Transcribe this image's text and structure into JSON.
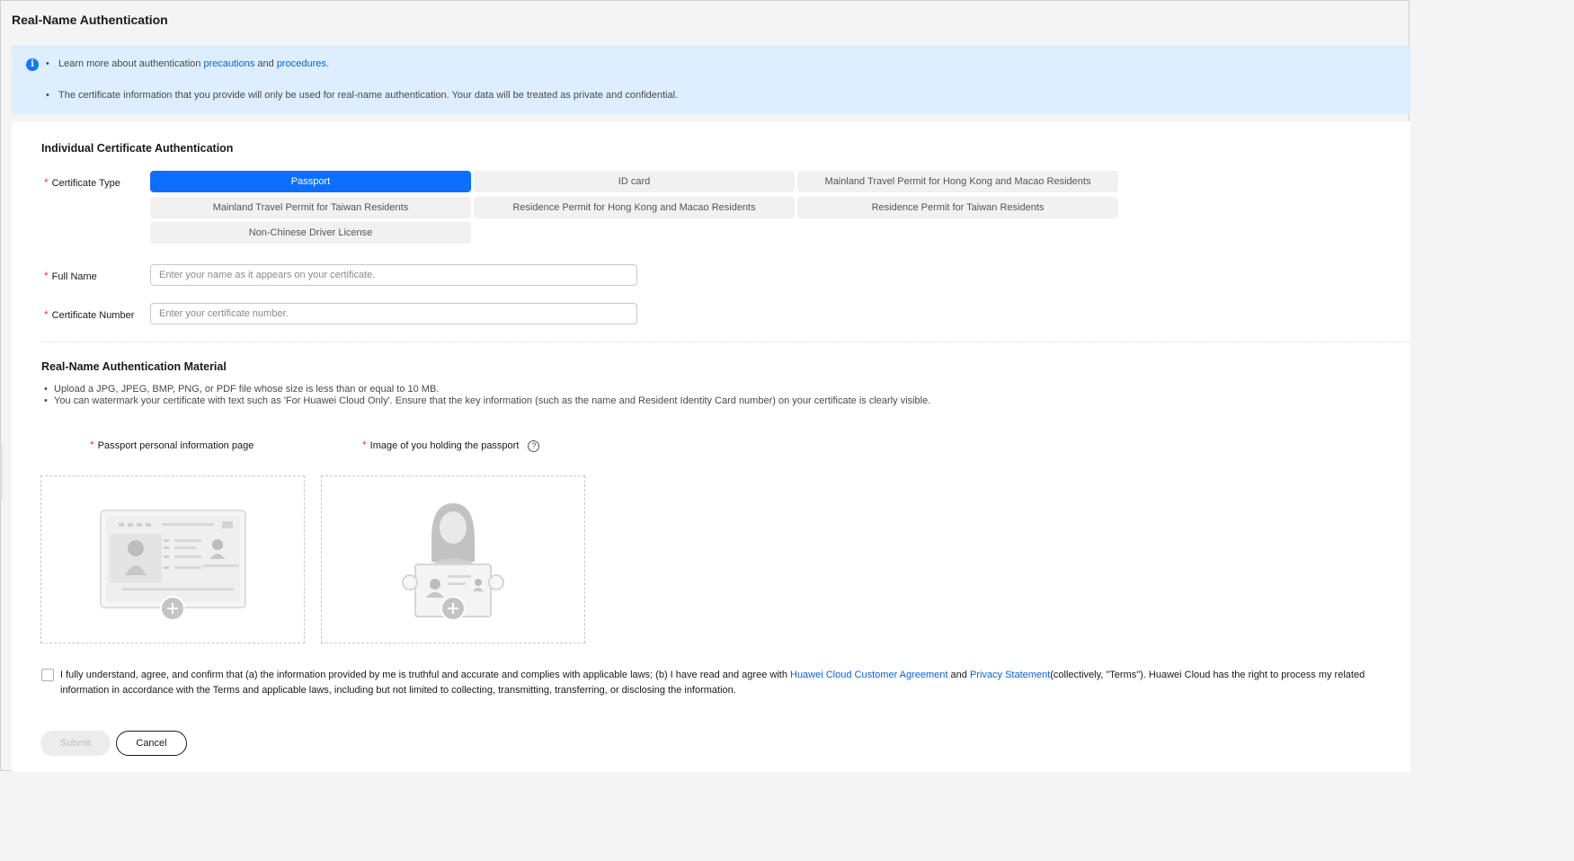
{
  "page": {
    "title": "Real-Name Authentication"
  },
  "notice": {
    "line1_prefix": "Learn more about authentication",
    "link_precautions": "precautions",
    "and": "and",
    "link_procedures": "procedures.",
    "line2": "The certificate information that you provide will only be used for real-name authentication. Your data will be treated as private and confidential."
  },
  "individual": {
    "section_title": "Individual Certificate Authentication",
    "certificate_type_label": "Certificate Type",
    "certificate_types": [
      "Passport",
      "ID card",
      "Mainland Travel Permit for Hong Kong and Macao Residents",
      "Mainland Travel Permit for Taiwan Residents",
      "Residence Permit for Hong Kong and Macao Residents",
      "Residence Permit for Taiwan Residents",
      "Non-Chinese Driver License"
    ],
    "selected_certificate_type": "Passport",
    "full_name_label": "Full Name",
    "full_name_placeholder": "Enter your name as it appears on your certificate.",
    "full_name_value": "",
    "certificate_number_label": "Certificate Number",
    "certificate_number_placeholder": "Enter your certificate number.",
    "certificate_number_value": ""
  },
  "material": {
    "section_title": "Real-Name Authentication Material",
    "notes": [
      "Upload a JPG, JPEG, BMP, PNG, or PDF file whose size is less than or equal to 10 MB.",
      "You can watermark your certificate with text such as 'For Huawei Cloud Only'. Ensure that the key information (such as the name and Resident Identity Card number) on your certificate is clearly visible."
    ],
    "upload_passport_label": "Passport personal information page",
    "upload_holding_label": "Image of you holding the passport"
  },
  "agreement": {
    "text_part1": "I fully understand, agree, and confirm that (a) the information provided by me is truthful and accurate and complies with applicable laws; (b) I have read and agree with",
    "link_customer_agreement": "Huawei Cloud Customer Agreement",
    "and": "and",
    "link_privacy": "Privacy Statement",
    "text_part2": "(collectively, \"Terms\"). Huawei Cloud has the right to process my related information in accordance with the Terms and applicable laws, including but not limited to collecting, transmitting, transferring, or disclosing the information.",
    "checked": false
  },
  "actions": {
    "submit_label": "Submit",
    "cancel_label": "Cancel"
  },
  "colors": {
    "accent": "#0d6fff",
    "link": "#0b62d6",
    "required": "#e3403b",
    "notice_bg": "#dceeff"
  }
}
